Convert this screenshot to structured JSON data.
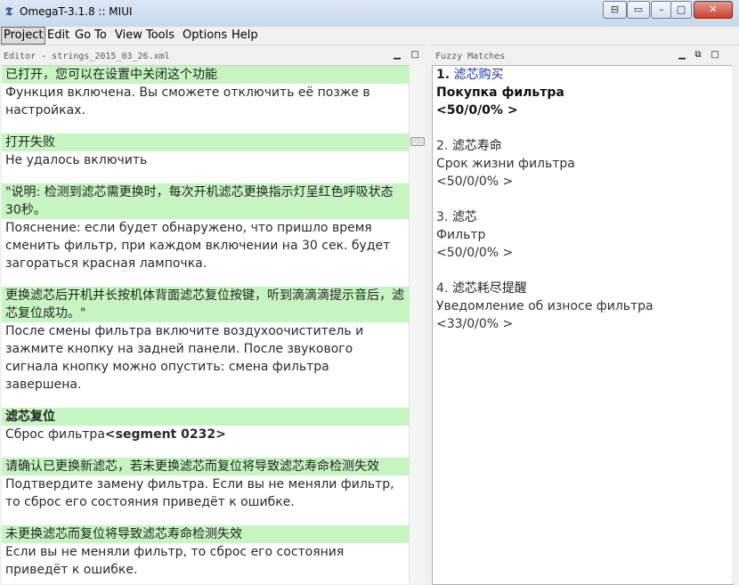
{
  "window": {
    "title": "OmegaT-3.1.8 :: MIUI",
    "icons": [
      "app-icon",
      "minimize-icon",
      "restore-icon",
      "close-icon"
    ]
  },
  "menu": [
    {
      "label": "Project",
      "active": true
    },
    {
      "label": "Edit"
    },
    {
      "label": "Go To"
    },
    {
      "label": "View"
    },
    {
      "label": "Tools"
    },
    {
      "label": "Options"
    },
    {
      "label": "Help"
    }
  ],
  "editor": {
    "header": "Editor - strings_2015_03_26.xml",
    "segments": [
      {
        "source": "已打开，您可以在设置中关闭这个功能",
        "target": "Функция включена. Вы сможете отключить её позже в настройках."
      },
      {
        "source": "打开失败",
        "target": "Не удалось включить"
      },
      {
        "source": "\"说明: 检测到滤芯需更换时，每次开机滤芯更换指示灯呈红色呼吸状态30秒。",
        "target": "Пояснение: если будет обнаружено, что пришло время сменить фильтр, при каждом включении на 30 сек. будет загораться красная лампочка."
      },
      {
        "source": "更换滤芯后开机并长按机体背面滤芯复位按键，听到滴滴滴提示音后，滤芯复位成功。\"",
        "target": "После смены фильтра включите воздухоочиститель и зажмите кнопку на задней панели. После звукового сигнала кнопку можно опустить: смена фильтра завершена."
      },
      {
        "source": "滤芯复位",
        "target": "Сброс фильтра",
        "tag": "<segment 0232>",
        "active": true
      },
      {
        "source": "请确认已更换新滤芯，若未更换滤芯而复位将导致滤芯寿命检测失效",
        "target": "Подтвердите замену фильтра. Если вы не меняли фильтр, то сброс его состояния приведёт к ошибке."
      },
      {
        "source": "未更换滤芯而复位将导致滤芯寿命检测失效",
        "target": "Если вы не меняли фильтр, то сброс его состояния приведёт к ошибке."
      }
    ]
  },
  "fuzzy": {
    "header": "Fuzzy Matches",
    "matches": [
      {
        "num": "1.",
        "source": "滤芯购买",
        "target": "Покупка фильтра",
        "score": "<50/0/0% >",
        "active": true
      },
      {
        "num": "2.",
        "source": "滤芯寿命",
        "target": "Срок жизни фильтра",
        "score": "<50/0/0% >"
      },
      {
        "num": "3.",
        "source": "滤芯",
        "target": "Фильтр",
        "score": "<50/0/0% >"
      },
      {
        "num": "4.",
        "source": "滤芯耗尽提醒",
        "target": "Уведомление об износе фильтра",
        "score": "<33/0/0% >"
      }
    ]
  }
}
